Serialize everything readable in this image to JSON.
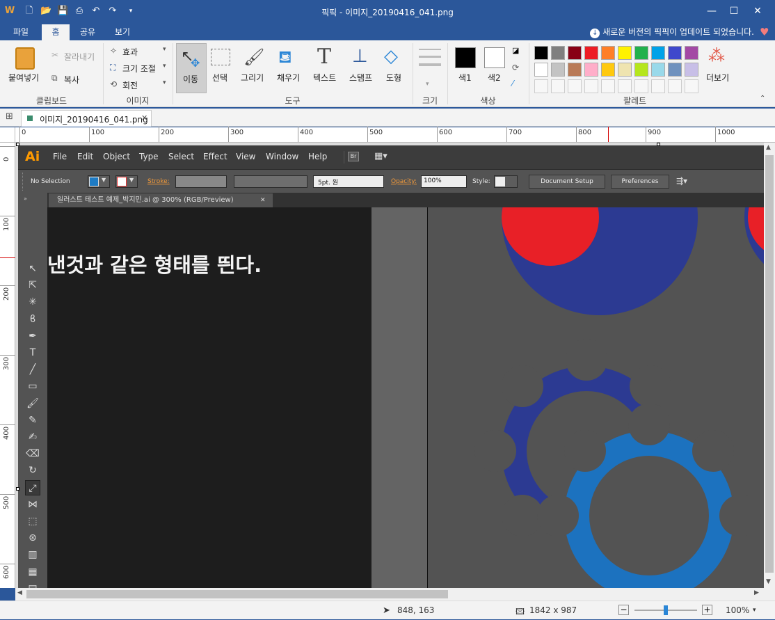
{
  "window": {
    "title": "픽픽 - 이미지_20190416_041.png",
    "update_notice": "새로운 버전의 픽픽이 업데이트 되었습니다."
  },
  "menu_tabs": [
    "파일",
    "홈",
    "공유",
    "보기"
  ],
  "ribbon": {
    "clipboard": {
      "paste": "붙여넣기",
      "cut": "잘라내기",
      "copy": "복사",
      "label": "클립보드"
    },
    "image": {
      "effects": "효과",
      "resize": "크기 조절",
      "rotate": "회전",
      "label": "이미지"
    },
    "tools": {
      "move": "이동",
      "select": "선택",
      "draw": "그리기",
      "fill": "채우기",
      "text": "텍스트",
      "stamp": "스탬프",
      "shape": "도형",
      "label": "도구"
    },
    "size": {
      "label": "크기"
    },
    "color": {
      "color1": "색1",
      "color2": "색2",
      "label": "색상"
    },
    "palette": {
      "label": "팔레트",
      "more": "더보기",
      "row1": [
        "#000000",
        "#7f7f7f",
        "#880015",
        "#ed1c24",
        "#ff7f27",
        "#fff200",
        "#22b14c",
        "#00a2e8",
        "#3f48cc",
        "#a349a4"
      ],
      "row2": [
        "#ffffff",
        "#c3c3c3",
        "#b97a57",
        "#ffaec9",
        "#ffc90e",
        "#efe4b0",
        "#b5e61d",
        "#99d9ea",
        "#7092be",
        "#c8bfe7"
      ]
    }
  },
  "document_tab": "이미지_20190416_041.png",
  "ruler": {
    "h": [
      "0",
      "100",
      "200",
      "300",
      "400",
      "500",
      "600",
      "700",
      "800",
      "900",
      "1000"
    ],
    "v": [
      "0",
      "100",
      "200",
      "300",
      "400",
      "500",
      "600"
    ]
  },
  "illustrator": {
    "logo": "Ai",
    "menus": [
      "File",
      "Edit",
      "Object",
      "Type",
      "Select",
      "Effect",
      "View",
      "Window",
      "Help"
    ],
    "bridge": "Br",
    "control": {
      "selection": "No Selection",
      "stroke_label": "Stroke:",
      "brush": "5pt. 원",
      "opacity_label": "Opacity:",
      "opacity_value": "100%",
      "style_label": "Style:",
      "doc_setup": "Document Setup",
      "preferences": "Preferences"
    },
    "doc_tab": "일러스트 테스트 예제_박지민.ai @ 300% (RGB/Preview)",
    "canvas_text": "낸것과 같은 형태를 띈다."
  },
  "status": {
    "cursor": "848, 163",
    "image_size": "1842 x 987",
    "zoom": "100%"
  }
}
